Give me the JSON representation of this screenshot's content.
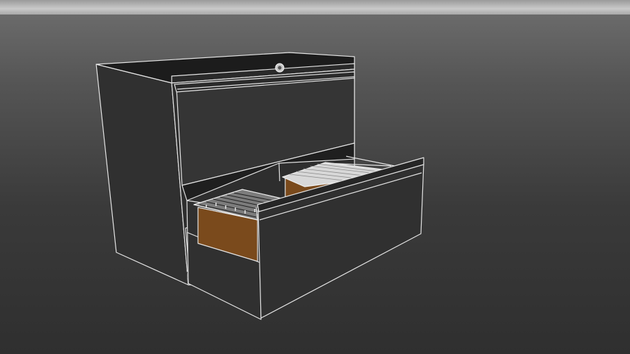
{
  "scene": {
    "subject": "lateral-file-cabinet",
    "drawer_count": 2,
    "open_drawer": "bottom",
    "colors": {
      "background_top": "#6f6f6f",
      "background_bottom": "#2f2f2f",
      "cabinet_body": "#343434",
      "cabinet_top": "#1f1f1f",
      "edge_lines": "#e6e6e6",
      "folder": "#7a4a1c",
      "folder_tabs": "#cfcfcf"
    }
  }
}
